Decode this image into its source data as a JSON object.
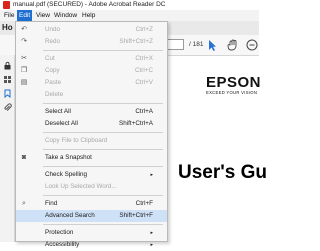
{
  "window": {
    "title": "manual.pdf (SECURED) - Adobe Acrobat Reader DC"
  },
  "menubar": [
    "File",
    "Edit",
    "View",
    "Window",
    "Help"
  ],
  "tab": {
    "label": "Ho"
  },
  "toolbar": {
    "page_count": "/ 181"
  },
  "edit_menu": {
    "undo": {
      "label": "Undo",
      "shortcut": "Ctrl+Z"
    },
    "redo": {
      "label": "Redo",
      "shortcut": "Shift+Ctrl+Z"
    },
    "cut": {
      "label": "Cut",
      "shortcut": "Ctrl+X"
    },
    "copy": {
      "label": "Copy",
      "shortcut": "Ctrl+C"
    },
    "paste": {
      "label": "Paste",
      "shortcut": "Ctrl+V"
    },
    "delete": {
      "label": "Delete"
    },
    "select_all": {
      "label": "Select All",
      "shortcut": "Ctrl+A"
    },
    "deselect_all": {
      "label": "Deselect All",
      "shortcut": "Shift+Ctrl+A"
    },
    "copy_clipboard": {
      "label": "Copy File to Clipboard"
    },
    "snapshot": {
      "label": "Take a Snapshot"
    },
    "spelling": {
      "label": "Check Spelling"
    },
    "lookup": {
      "label": "Look Up Selected Word..."
    },
    "find": {
      "label": "Find",
      "shortcut": "Ctrl+F"
    },
    "advanced_search": {
      "label": "Advanced Search",
      "shortcut": "Shift+Ctrl+F"
    },
    "protection": {
      "label": "Protection"
    },
    "accessibility": {
      "label": "Accessibility"
    }
  },
  "document": {
    "logo": "EPSON",
    "tagline": "EXCEED YOUR VISION",
    "heading": "User's Gu"
  },
  "colors": {
    "menu_active": "#1f6fd1",
    "highlight": "#cfe1f7",
    "acrobat_red": "#d8261c",
    "toolbar_blue": "#2b6fd6"
  }
}
